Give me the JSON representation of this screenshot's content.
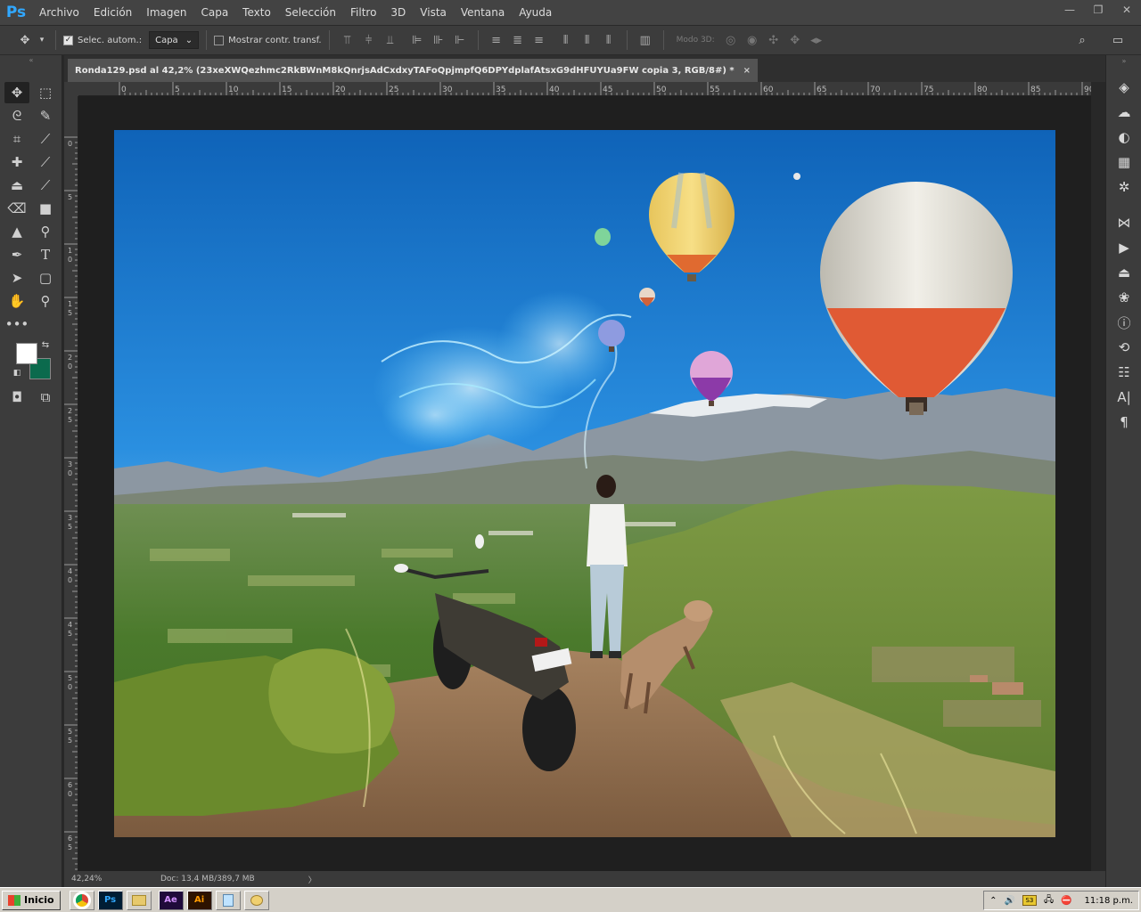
{
  "app": {
    "logo": "Ps"
  },
  "menu": [
    "Archivo",
    "Edición",
    "Imagen",
    "Capa",
    "Texto",
    "Selección",
    "Filtro",
    "3D",
    "Vista",
    "Ventana",
    "Ayuda"
  ],
  "window_controls": {
    "minimize": "—",
    "restore": "❐",
    "close": "✕"
  },
  "options": {
    "auto_select_label": "Selec. autom.:",
    "auto_select_checked": true,
    "auto_select_target": "Capa",
    "show_transform_label": "Mostrar contr. transf.",
    "show_transform_checked": false,
    "mode3d_label": "Modo 3D:"
  },
  "document": {
    "tab_title": "Ronda129.psd al 42,2% (23xeXWQezhmc2RkBWnM8kQnrjsAdCxdxyTAFoQpjmpfQ6DPYdplafAtsxG9dHFUYUa9FW copia 3, RGB/8#) *",
    "close": "×"
  },
  "ruler_h": [
    "0",
    "5",
    "10",
    "15",
    "20",
    "25",
    "30",
    "35",
    "40",
    "45",
    "50",
    "55",
    "60",
    "65",
    "70",
    "75",
    "80",
    "85",
    "90"
  ],
  "ruler_v": [
    "0",
    "5",
    "1 0",
    "1 5",
    "2 0",
    "2 5",
    "3 0",
    "3 5",
    "4 0",
    "4 5",
    "5 0",
    "5 5",
    "6 0",
    "6 5"
  ],
  "status": {
    "zoom": "42,24%",
    "doc": "Doc: 13,4 MB/389,7 MB",
    "arrow": "〉"
  },
  "colors": {
    "foreground": "#ffffff",
    "background": "#0b6a4d",
    "accent": "#31a8ff"
  },
  "taskbar": {
    "start_label": "Inicio",
    "apps": [
      "chrome-icon",
      "photoshop-icon",
      "explorer-icon",
      "after-effects-icon",
      "illustrator-icon",
      "notepad-icon",
      "paint-icon"
    ],
    "app_labels": {
      "ps": "Ps",
      "ae": "Ae",
      "ai": "Ai"
    },
    "clock": "11:18 p.m."
  }
}
